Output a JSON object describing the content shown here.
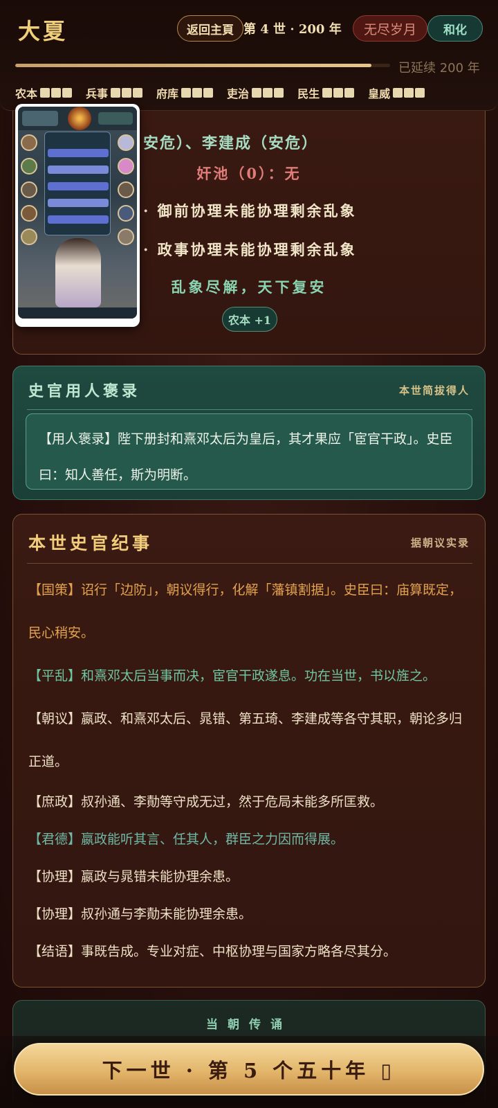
{
  "header": {
    "title": "大夏",
    "home_label": "返回主頁",
    "generation_text": "第 4 世 · 200 年",
    "endless_label": "无尽岁月",
    "peace_label": "和化",
    "progress_percent": 95,
    "progress_text": "已延续 200 年",
    "stats": [
      {
        "label": "农本",
        "pips": 3
      },
      {
        "label": "兵事",
        "pips": 3
      },
      {
        "label": "府库",
        "pips": 3
      },
      {
        "label": "吏治",
        "pips": 3
      },
      {
        "label": "民生",
        "pips": 3
      },
      {
        "label": "皇威",
        "pips": 3
      }
    ]
  },
  "result_card": {
    "line_minister": "安危）、李建成（安危）",
    "line_traitor": "奸池（0）：无",
    "line_imperial": "· 御前协理未能协理剩余乱象",
    "line_govern": "· 政事协理未能协理剩余乱象",
    "line_peace": "乱象尽解，天下复安",
    "badge": "农本 +1"
  },
  "praise_card": {
    "title": "史官用人褒录",
    "subtitle": "本世简拔得人",
    "text": "【用人褒录】陛下册封和熹邓太后为皇后，其才果应「宦官干政」。史臣曰：知人善任，斯为明断。"
  },
  "chronicle": {
    "title": "本世史官纪事",
    "subtitle": "据朝议实录",
    "entries": [
      {
        "text": "【国策】诏行「边防」，朝议得行，化解「藩镇割据」。史臣曰：庙算既定，民心稍安。",
        "color": "#e2a24e"
      },
      {
        "text": "【平乱】和熹邓太后当事而决，宦官干政遂息。功在当世，书以旌之。",
        "color": "#6fc6a2"
      },
      {
        "text": "【朝议】嬴政、和熹邓太后、晁错、第五琦、李建成等各守其职，朝论多归正道。",
        "color": "#eee0c6"
      },
      {
        "text": "【庶政】叔孙通、李勣等守成无过，然于危局未能多所匡救。",
        "color": "#eee0c6"
      },
      {
        "text": "【君德】嬴政能听其言、任其人，群臣之力因而得展。",
        "color": "#6fb8a6"
      },
      {
        "text": "【协理】嬴政与晁错未能协理余患。",
        "color": "#eee0c6"
      },
      {
        "text": "【协理】叔孙通与李勣未能协理余患。",
        "color": "#eee0c6"
      },
      {
        "text": "【结语】事既告成。专业对症、中枢协理与国家方略各尽其分。",
        "color": "#eee0c6"
      }
    ]
  },
  "recital": {
    "title": "当朝传诵"
  },
  "footer": {
    "next_label": "下一世 · 第 5 个五十年 ▯"
  },
  "colors": {
    "accent_gold": "#f0cf7a",
    "teal": "#6fc6a2",
    "traitor_red": "#e07d7a"
  }
}
